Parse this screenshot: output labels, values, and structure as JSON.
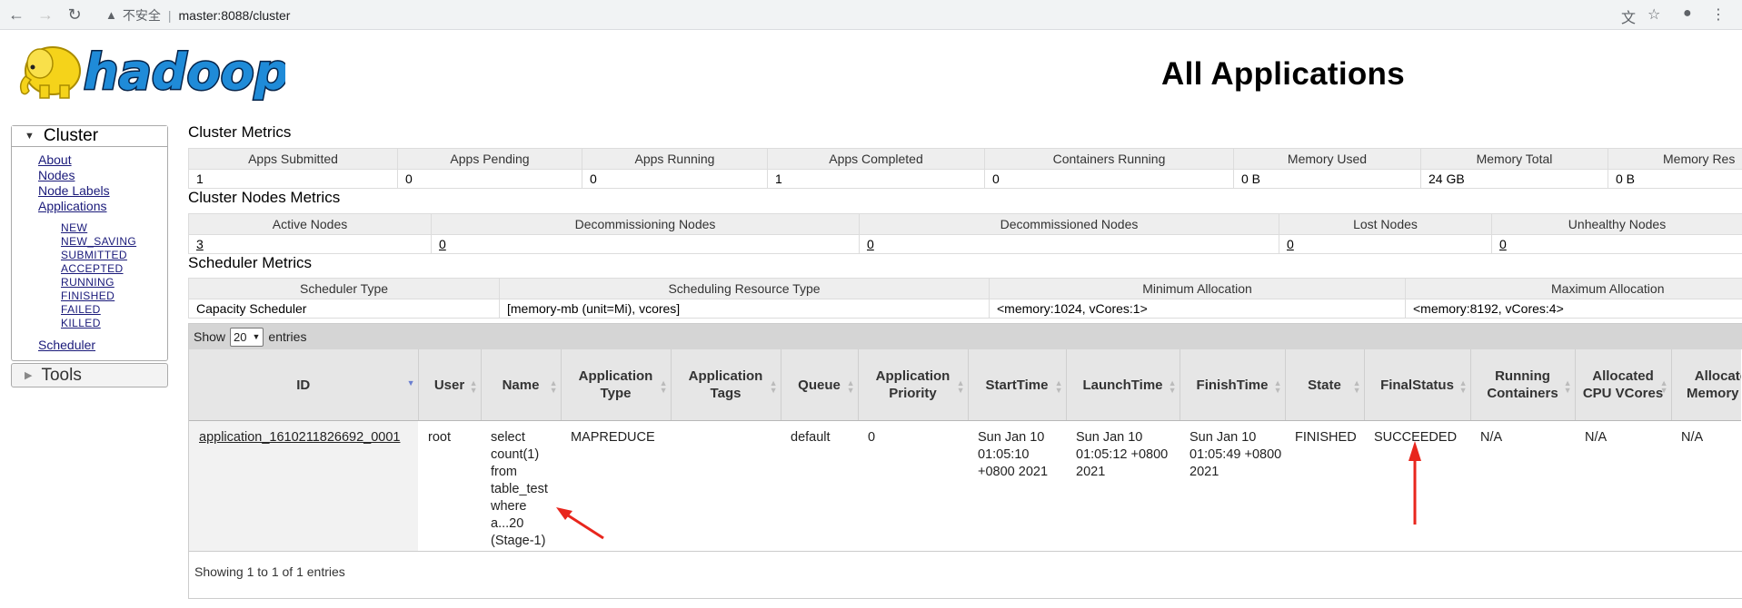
{
  "browser": {
    "security_label": "不安全",
    "url": "master:8088/cluster"
  },
  "page": {
    "title": "All Applications"
  },
  "sidebar": {
    "cluster_label": "Cluster",
    "links": [
      "About",
      "Nodes",
      "Node Labels",
      "Applications"
    ],
    "app_states": [
      "NEW",
      "NEW_SAVING",
      "SUBMITTED",
      "ACCEPTED",
      "RUNNING",
      "FINISHED",
      "FAILED",
      "KILLED"
    ],
    "scheduler_label": "Scheduler",
    "tools_label": "Tools"
  },
  "cluster_metrics": {
    "title": "Cluster Metrics",
    "headers": [
      "Apps Submitted",
      "Apps Pending",
      "Apps Running",
      "Apps Completed",
      "Containers Running",
      "Memory Used",
      "Memory Total",
      "Memory Res"
    ],
    "values": [
      "1",
      "0",
      "0",
      "1",
      "0",
      "0 B",
      "24 GB",
      "0 B"
    ]
  },
  "node_metrics": {
    "title": "Cluster Nodes Metrics",
    "headers": [
      "Active Nodes",
      "Decommissioning Nodes",
      "Decommissioned Nodes",
      "Lost Nodes",
      "Unhealthy Nodes"
    ],
    "values": [
      "3",
      "0",
      "0",
      "0",
      "0"
    ]
  },
  "scheduler_metrics": {
    "title": "Scheduler Metrics",
    "headers": [
      "Scheduler Type",
      "Scheduling Resource Type",
      "Minimum Allocation",
      "Maximum Allocation"
    ],
    "values": [
      "Capacity Scheduler",
      "[memory-mb (unit=Mi), vcores]",
      "<memory:1024, vCores:1>",
      "<memory:8192, vCores:4>"
    ]
  },
  "apps": {
    "show_label": "Show",
    "page_size": "20",
    "entries_label": "entries",
    "columns": [
      "ID",
      "User",
      "Name",
      "Application Type",
      "Application Tags",
      "Queue",
      "Application Priority",
      "StartTime",
      "LaunchTime",
      "FinishTime",
      "State",
      "FinalStatus",
      "Running Containers",
      "Allocated CPU VCores",
      "Allocated Memory MB"
    ],
    "row": {
      "id": "application_1610211826692_0001",
      "user": "root",
      "name": "select count(1) from table_test where a...20 (Stage-1)",
      "type": "MAPREDUCE",
      "tags": "",
      "queue": "default",
      "priority": "0",
      "start": "Sun Jan 10 01:05:10 +0800 2021",
      "launch": "Sun Jan 10 01:05:12 +0800 2021",
      "finish": "Sun Jan 10 01:05:49 +0800 2021",
      "state": "FINISHED",
      "final_status": "SUCCEEDED",
      "running_containers": "N/A",
      "cpu": "N/A",
      "memory": "N/A"
    },
    "footer": "Showing 1 to 1 of 1 entries"
  },
  "colors": {
    "link": "#1a1a7a",
    "annotation_arrow": "#e8261d",
    "logo_yellow": "#f5d31a",
    "logo_blue": "#1f8bd8"
  }
}
